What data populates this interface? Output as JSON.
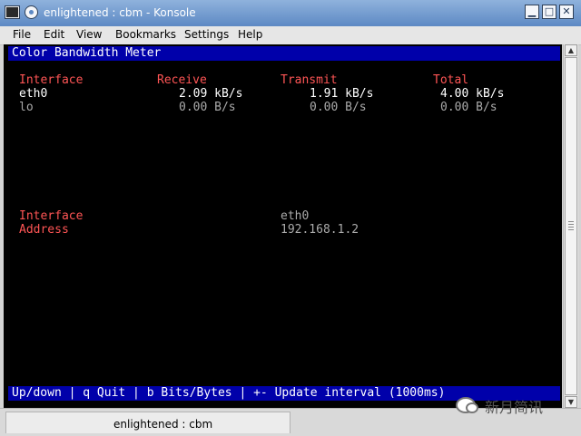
{
  "window": {
    "title": "enlightened : cbm - Konsole",
    "minimize_glyph": "▁",
    "maximize_glyph": "□",
    "close_glyph": "✕"
  },
  "menu": [
    "File",
    "Edit",
    "View",
    "Bookmarks",
    "Settings",
    "Help"
  ],
  "terminal": {
    "header_bar": "Color Bandwidth Meter",
    "table_headers": [
      "Interface",
      "Receive",
      "Transmit",
      "Total"
    ],
    "rows": [
      {
        "interface": "eth0",
        "receive": "2.09 kB/s",
        "transmit": "1.91 kB/s",
        "total": "4.00 kB/s"
      },
      {
        "interface": "lo",
        "receive": "0.00 B/s",
        "transmit": "0.00 B/s",
        "total": "0.00 B/s"
      }
    ],
    "details": {
      "interface_label": "Interface",
      "interface_value": "eth0",
      "address_label": "Address",
      "address_value": "192.168.1.2"
    },
    "footer_bar": "Up/down | q Quit | b Bits/Bytes | +- Update interval (1000ms)"
  },
  "tabs": [
    {
      "label": "enlightened : cbm"
    }
  ],
  "watermark": {
    "text": "新月简讯"
  },
  "colors": {
    "bar_background": "#0000aa",
    "label_red": "#ff5555",
    "value_white": "#ffffff",
    "value_gray": "#aaaaaa"
  }
}
